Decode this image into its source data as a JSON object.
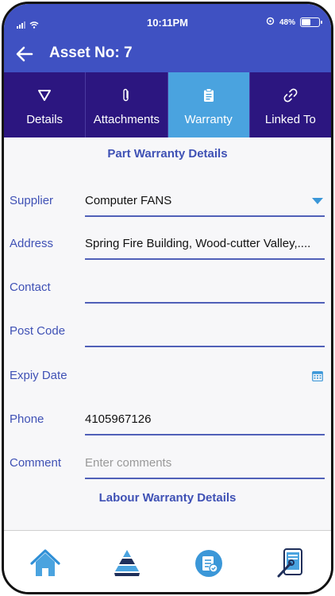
{
  "status_bar": {
    "time": "10:11PM",
    "battery": "48%",
    "battery_level": 0.48
  },
  "header": {
    "title": "Asset No: 7"
  },
  "tabs": [
    {
      "label": "Details",
      "icon": "triangle-down-outline-icon"
    },
    {
      "label": "Attachments",
      "icon": "paperclip-icon"
    },
    {
      "label": "Warranty",
      "icon": "clipboard-icon",
      "active": true
    },
    {
      "label": "Linked To",
      "icon": "link-icon"
    }
  ],
  "part_warranty": {
    "title": "Part Warranty Details",
    "fields": {
      "supplier": {
        "label": "Supplier",
        "value": "Computer FANS"
      },
      "address": {
        "label": "Address",
        "value": "Spring Fire Building, Wood-cutter Valley,...."
      },
      "contact": {
        "label": "Contact",
        "value": ""
      },
      "post_code": {
        "label": "Post Code",
        "value": ""
      },
      "expiry_date": {
        "label": "Expiy Date",
        "value": ""
      },
      "phone": {
        "label": "Phone",
        "value": "4105967126"
      },
      "comment": {
        "label": "Comment",
        "value": "",
        "placeholder": "Enter comments"
      }
    }
  },
  "labour_warranty": {
    "title": "Labour Warranty Details"
  },
  "bottom_nav": [
    "home-icon",
    "layers-pyramid-icon",
    "checklist-icon",
    "tablet-tools-icon"
  ],
  "colors": {
    "primary": "#3f51c2",
    "tab_bar": "#2c1680",
    "tab_active": "#4aa3df",
    "accent": "#3b97d8"
  }
}
